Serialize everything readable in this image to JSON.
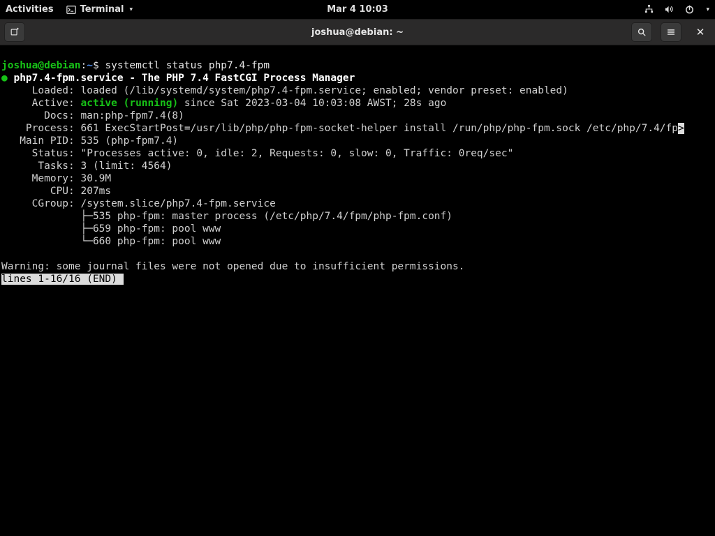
{
  "topbar": {
    "activities": "Activities",
    "app_name": "Terminal",
    "clock": "Mar 4  10:03"
  },
  "titlebar": {
    "title": "joshua@debian: ~"
  },
  "prompt": {
    "user_host": "joshua@debian",
    "sep": ":",
    "path": "~",
    "dollar": "$ ",
    "command": "systemctl status php7.4-fpm"
  },
  "status": {
    "unit_line": " php7.4-fpm.service - The PHP 7.4 FastCGI Process Manager",
    "loaded": "     Loaded: loaded (/lib/systemd/system/php7.4-fpm.service; enabled; vendor preset: enabled)",
    "active_label": "     Active: ",
    "active_value": "active (running)",
    "active_since": " since Sat 2023-03-04 10:03:08 AWST; 28s ago",
    "docs": "       Docs: man:php-fpm7.4(8)",
    "process": "    Process: 661 ExecStartPost=/usr/lib/php/php-fpm-socket-helper install /run/php/php-fpm.sock /etc/php/7.4/fp",
    "mainpid": "   Main PID: 535 (php-fpm7.4)",
    "statusln": "     Status: \"Processes active: 0, idle: 2, Requests: 0, slow: 0, Traffic: 0req/sec\"",
    "tasks": "      Tasks: 3 (limit: 4564)",
    "memory": "     Memory: 30.9M",
    "cpu": "        CPU: 207ms",
    "cgroup": "     CGroup: /system.slice/php7.4-fpm.service",
    "tree1": "             ├─535 php-fpm: master process (/etc/php/7.4/fpm/php-fpm.conf)",
    "tree2": "             ├─659 php-fpm: pool www",
    "tree3": "             └─660 php-fpm: pool www",
    "blank": "",
    "warn": "Warning: some journal files were not opened due to insufficient permissions.",
    "pager": "lines 1-16/16 (END)"
  }
}
